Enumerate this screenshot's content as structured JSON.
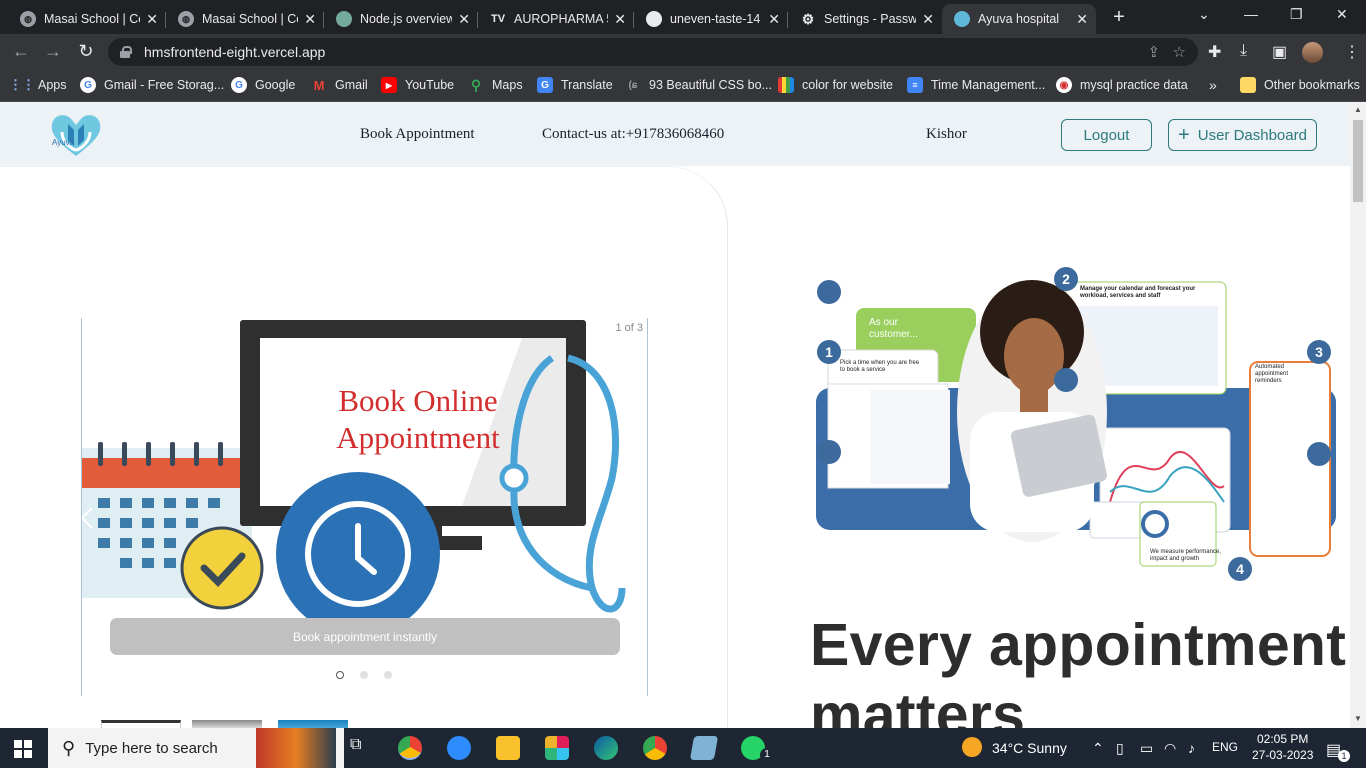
{
  "browser": {
    "tabs": [
      {
        "title": "Masai School | Co",
        "icon": "globe-icon"
      },
      {
        "title": "Masai School | Co",
        "icon": "globe-icon"
      },
      {
        "title": "Node.js overview.",
        "icon": "chatgpt-icon"
      },
      {
        "title": "AUROPHARMA 5",
        "icon": "tradingview-icon"
      },
      {
        "title": "uneven-taste-14",
        "icon": "github-icon"
      },
      {
        "title": "Settings - Passwo",
        "icon": "gear-icon"
      },
      {
        "title": "Ayuva hospital",
        "icon": "heart-icon",
        "active": true
      }
    ],
    "url": "hmsfrontend-eight.vercel.app",
    "bookmarks": [
      {
        "label": "Apps",
        "icon": "apps-grid-icon"
      },
      {
        "label": "Gmail - Free Storag...",
        "icon": "google-icon"
      },
      {
        "label": "Google",
        "icon": "google-icon"
      },
      {
        "label": "Gmail",
        "icon": "gmail-icon"
      },
      {
        "label": "YouTube",
        "icon": "youtube-icon"
      },
      {
        "label": "Maps",
        "icon": "maps-icon"
      },
      {
        "label": "Translate",
        "icon": "translate-icon"
      },
      {
        "label": "93 Beautiful CSS bo...",
        "icon": "css-icon"
      },
      {
        "label": "color for website",
        "icon": "palette-icon"
      },
      {
        "label": "Time Management...",
        "icon": "docs-icon"
      },
      {
        "label": "mysql practice data",
        "icon": "mysql-icon"
      }
    ],
    "more_bookmarks": "»",
    "other_bookmarks": "Other bookmarks"
  },
  "site": {
    "logo_text": "Ayuva",
    "nav": {
      "book": "Book Appointment",
      "contact": "Contact-us at:+917836068460",
      "user": "Kishor",
      "logout": "Logout",
      "dashboard": "User Dashboard"
    },
    "slider": {
      "counter": "1 of 3",
      "headline_line1": "Book Online",
      "headline_line2": "Appointment",
      "caption": "Book appointment instantly",
      "active_slide": 1,
      "slide_count": 3
    },
    "promo": {
      "our_customer": "As our customer...",
      "step1": "Pick a time when you are free to book a service",
      "step2": "Manage your calendar and forecast your workload, services and staff",
      "step3": "Automated appointment reminders",
      "step4": "We measure performance, impact and growth",
      "n1": "1",
      "n2": "2",
      "n3": "3",
      "n4": "4"
    },
    "hero_heading_line1": "Every appointment",
    "hero_heading_line2": "matters"
  },
  "taskbar": {
    "search_placeholder": "Type here to search",
    "weather": "34°C  Sunny",
    "lang": "ENG",
    "time": "02:05 PM",
    "date": "27-03-2023",
    "notifications": "1"
  },
  "colors": {
    "accent": "#2c7a7b",
    "nav_bg": "#edf2f7",
    "chrome_dark": "#202124"
  }
}
